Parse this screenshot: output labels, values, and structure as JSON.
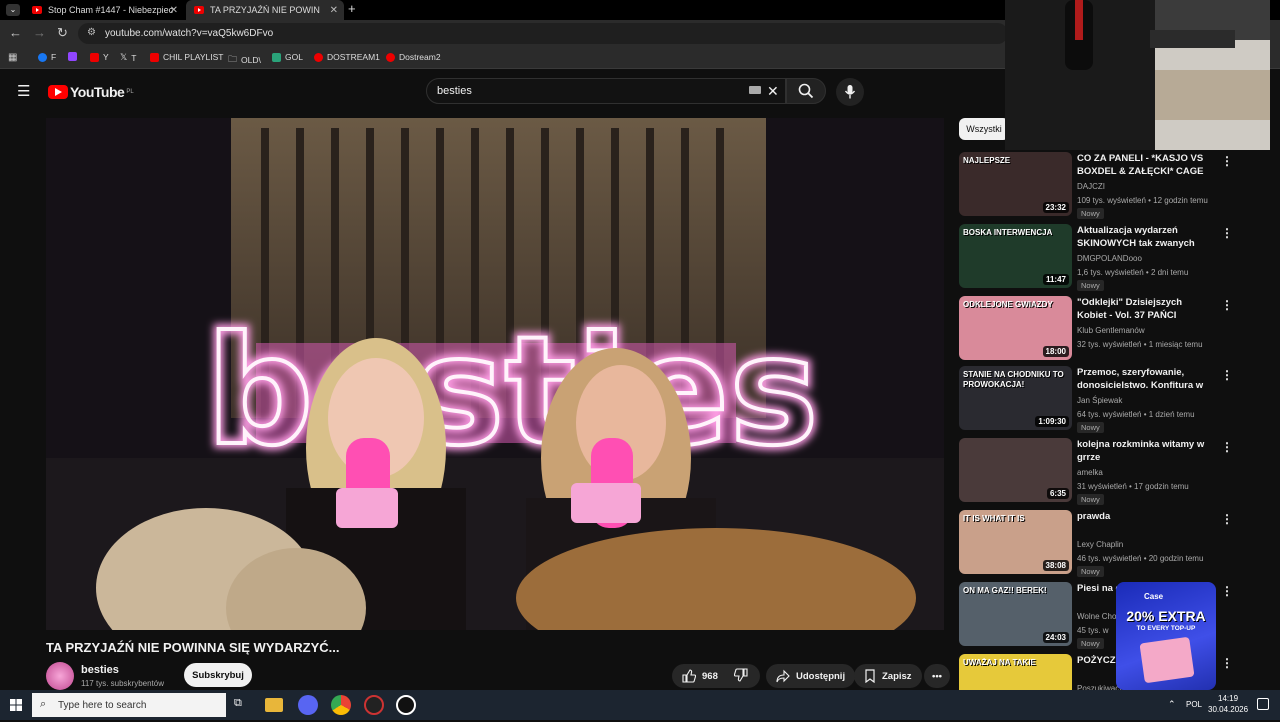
{
  "browser": {
    "tabs": [
      {
        "label": "Stop Cham #1447 - Niebezpiec",
        "active": false
      },
      {
        "label": "TA PRZYJAŹŃ NIE POWINNA SI",
        "active": true
      }
    ],
    "url": "youtube.com/watch?v=vaQ5kw6DFvo",
    "bookmarks": [
      "F",
      "Y",
      "T",
      "CHIL PLAYLIST",
      "OLD\\",
      "GOL",
      "DOSTREAM1",
      "Dostream2"
    ]
  },
  "youtube": {
    "logo": "YouTube",
    "region": "PL",
    "search_value": "besties"
  },
  "video": {
    "title": "TA PRZYJAŹŃ NIE POWINNA SIĘ WYDARZYĆ...",
    "neon_text": "besties",
    "channel": "besties",
    "subscribers": "117 tys. subskrybentów",
    "subscribe_label": "Subskrybuj",
    "likes": "968",
    "share_label": "Udostępnij",
    "save_label": "Zapisz"
  },
  "sidebar": {
    "filter_chip": "Wszystki",
    "items": [
      {
        "title": "CO ZA PANELI - *KASJO VS BOXDEL & ZAŁĘCKI* CAGE ...",
        "channel": "DAJCZI",
        "meta": "109 tys. wyświetleń • 12 godzin temu",
        "badge": "Nowy",
        "duration": "23:32",
        "thumb_text": "NAJLEPSZE",
        "thumb_color": "#3a2a2a"
      },
      {
        "title": "Aktualizacja wydarzeń SKINOWYCH tak zwanych 🔥...",
        "channel": "DMGPOLANDooo",
        "meta": "1,6 tys. wyświetleń • 2 dni temu",
        "badge": "Nowy",
        "duration": "11:47",
        "thumb_text": "BOSKA INTERWENCJA",
        "thumb_color": "#1f3b2a"
      },
      {
        "title": "\"Odklejki\" Dzisiejszych Kobiet - Vol. 37 PAŃCI POTRZEBNA ...",
        "channel": "Klub Gentlemanów",
        "meta": "32 tys. wyświetleń • 1 miesiąc temu",
        "badge": "",
        "duration": "18:00",
        "thumb_text": "ODKLEJONE GWIAZDY",
        "thumb_color": "#d98a9a"
      },
      {
        "title": "Przemoc, szeryfowanie, donosicielstwo. Konfitura w ...",
        "channel": "Jan Śpiewak",
        "meta": "64 tys. wyświetleń • 1 dzień temu",
        "badge": "Nowy",
        "duration": "1:09:30",
        "thumb_text": "STANIE NA CHODNIKU TO PROWOKACJA!",
        "thumb_color": "#2a2a30"
      },
      {
        "title": "kolejna rozkminka witamy w grrze",
        "channel": "amelka",
        "meta": "31 wyświetleń • 17 godzin temu",
        "badge": "Nowy",
        "duration": "6:35",
        "thumb_text": "",
        "thumb_color": "#4a3a3a"
      },
      {
        "title": "prawda",
        "channel": "Lexy Chaplin",
        "meta": "46 tys. wyświetleń • 20 godzin temu",
        "badge": "Nowy",
        "duration": "38:08",
        "thumb_text": "IT IS WHAT IT IS",
        "thumb_color": "#c9a08a"
      },
      {
        "title": "Piesi na g widziani (",
        "channel": "Wolne Cho",
        "meta": "45 tys. w",
        "badge": "Nowy",
        "duration": "24:03",
        "thumb_text": "ON MA GAZ!! BEREK!",
        "thumb_color": "#55606a"
      },
      {
        "title": "POŻYCZK OLX BEZ BIK I",
        "channel": "Poszukiwacze Ok",
        "meta": "",
        "badge": "",
        "duration": "",
        "thumb_text": "UWAŻAJ NA TAKIE",
        "thumb_color": "#e6c93a"
      }
    ]
  },
  "ad": {
    "brand": "Case",
    "headline": "20% EXTRA",
    "sub": "TO EVERY TOP-UP"
  },
  "taskbar": {
    "search_placeholder": "Type here to search",
    "language": "POL",
    "time": "14:19",
    "date": "30.04.2026"
  }
}
